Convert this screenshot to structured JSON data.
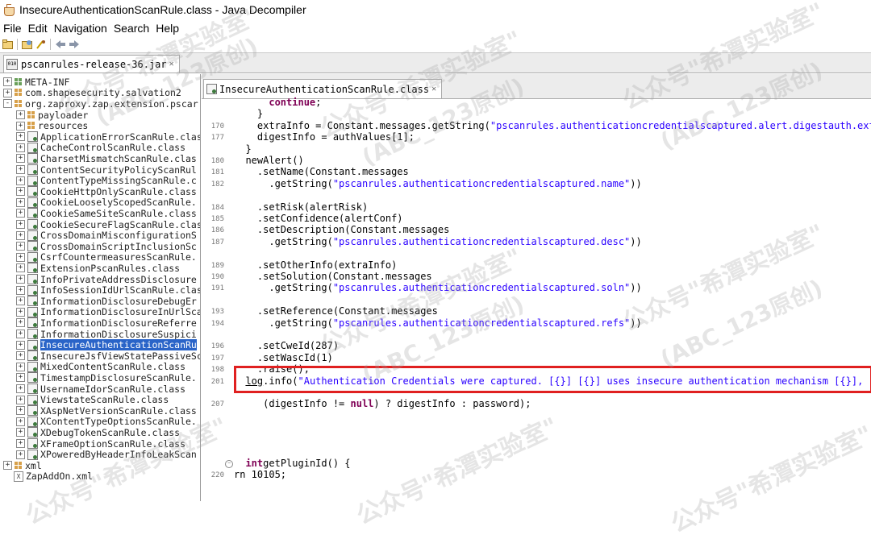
{
  "window": {
    "title": "InsecureAuthenticationScanRule.class - Java Decompiler"
  },
  "menu": [
    "File",
    "Edit",
    "Navigation",
    "Search",
    "Help"
  ],
  "jar_tab": {
    "label": "pscanrules-release-36.jar"
  },
  "code_tab": {
    "label": "InsecureAuthenticationScanRule.class"
  },
  "tree": [
    {
      "label": "META-INF",
      "type": "pkg-green",
      "depth": 0,
      "expander": "+"
    },
    {
      "label": "com.shapesecurity.salvation2",
      "type": "pkg",
      "depth": 0,
      "expander": "+"
    },
    {
      "label": "org.zaproxy.zap.extension.pscar",
      "type": "pkg",
      "depth": 0,
      "expander": "-"
    },
    {
      "label": "payloader",
      "type": "pkg",
      "depth": 1,
      "expander": "+"
    },
    {
      "label": "resources",
      "type": "pkg",
      "depth": 1,
      "expander": "+"
    },
    {
      "label": "ApplicationErrorScanRule.clas",
      "type": "cls",
      "depth": 1,
      "expander": "+"
    },
    {
      "label": "CacheControlScanRule.class",
      "type": "cls",
      "depth": 1,
      "expander": "+"
    },
    {
      "label": "CharsetMismatchScanRule.clas",
      "type": "cls",
      "depth": 1,
      "expander": "+"
    },
    {
      "label": "ContentSecurityPolicyScanRul",
      "type": "cls",
      "depth": 1,
      "expander": "+"
    },
    {
      "label": "ContentTypeMissingScanRule.c",
      "type": "cls",
      "depth": 1,
      "expander": "+"
    },
    {
      "label": "CookieHttpOnlyScanRule.class",
      "type": "cls",
      "depth": 1,
      "expander": "+"
    },
    {
      "label": "CookieLooselyScopedScanRule.",
      "type": "cls",
      "depth": 1,
      "expander": "+"
    },
    {
      "label": "CookieSameSiteScanRule.class",
      "type": "cls",
      "depth": 1,
      "expander": "+"
    },
    {
      "label": "CookieSecureFlagScanRule.clas",
      "type": "cls",
      "depth": 1,
      "expander": "+"
    },
    {
      "label": "CrossDomainMisconfigurationS",
      "type": "cls",
      "depth": 1,
      "expander": "+"
    },
    {
      "label": "CrossDomainScriptInclusionSc",
      "type": "cls",
      "depth": 1,
      "expander": "+"
    },
    {
      "label": "CsrfCountermeasuresScanRule.",
      "type": "cls",
      "depth": 1,
      "expander": "+"
    },
    {
      "label": "ExtensionPscanRules.class",
      "type": "cls",
      "depth": 1,
      "expander": "+"
    },
    {
      "label": "InfoPrivateAddressDisclosure",
      "type": "cls",
      "depth": 1,
      "expander": "+"
    },
    {
      "label": "InfoSessionIdUrlScanRule.clas",
      "type": "cls",
      "depth": 1,
      "expander": "+"
    },
    {
      "label": "InformationDisclosureDebugEr",
      "type": "cls",
      "depth": 1,
      "expander": "+"
    },
    {
      "label": "InformationDisclosureInUrlSca",
      "type": "cls",
      "depth": 1,
      "expander": "+"
    },
    {
      "label": "InformationDisclosureReferre",
      "type": "cls",
      "depth": 1,
      "expander": "+"
    },
    {
      "label": "InformationDisclosureSuspici",
      "type": "cls",
      "depth": 1,
      "expander": "+"
    },
    {
      "label": "InsecureAuthenticationScanRu",
      "type": "cls",
      "depth": 1,
      "expander": "+",
      "selected": true
    },
    {
      "label": "InsecureJsfViewStatePassiveSc",
      "type": "cls",
      "depth": 1,
      "expander": "+"
    },
    {
      "label": "MixedContentScanRule.class",
      "type": "cls",
      "depth": 1,
      "expander": "+"
    },
    {
      "label": "TimestampDisclosureScanRule.",
      "type": "cls",
      "depth": 1,
      "expander": "+"
    },
    {
      "label": "UsernameIdorScanRule.class",
      "type": "cls",
      "depth": 1,
      "expander": "+"
    },
    {
      "label": "ViewstateScanRule.class",
      "type": "cls",
      "depth": 1,
      "expander": "+"
    },
    {
      "label": "XAspNetVersionScanRule.class",
      "type": "cls",
      "depth": 1,
      "expander": "+"
    },
    {
      "label": "XContentTypeOptionsScanRule.",
      "type": "cls",
      "depth": 1,
      "expander": "+"
    },
    {
      "label": "XDebugTokenScanRule.class",
      "type": "cls",
      "depth": 1,
      "expander": "+"
    },
    {
      "label": "XFrameOptionScanRule.class",
      "type": "cls",
      "depth": 1,
      "expander": "+"
    },
    {
      "label": "XPoweredByHeaderInfoLeakScan",
      "type": "cls",
      "depth": 1,
      "expander": "+"
    },
    {
      "label": "xml",
      "type": "pkg",
      "depth": 0,
      "expander": "+"
    },
    {
      "label": "ZapAddOn.xml",
      "type": "xml",
      "depth": 0,
      "expander": ""
    }
  ],
  "code": [
    {
      "ln": "",
      "parts": [
        [
          "",
          "      "
        ],
        [
          "kw",
          "continue"
        ],
        [
          "",
          ";"
        ]
      ]
    },
    {
      "ln": "",
      "parts": [
        [
          "",
          "    }"
        ]
      ]
    },
    {
      "ln": "170",
      "parts": [
        [
          "",
          "    extraInfo = Constant.messages.getString("
        ],
        [
          "str",
          "\"pscanrules.authenticationcredentialscaptured.alert.digestauth.extrainfo\""
        ],
        [
          "",
          ","
        ]
      ]
    },
    {
      "ln": "177",
      "parts": [
        [
          "",
          "    digestInfo = authValues[1];"
        ]
      ]
    },
    {
      "ln": "",
      "parts": [
        [
          "",
          "  }"
        ]
      ]
    },
    {
      "ln": "180",
      "parts": [
        [
          "",
          "  newAlert()"
        ]
      ]
    },
    {
      "ln": "181",
      "parts": [
        [
          "",
          "    .setName(Constant.messages"
        ]
      ]
    },
    {
      "ln": "182",
      "parts": [
        [
          "",
          "      .getString("
        ],
        [
          "str",
          "\"pscanrules.authenticationcredentialscaptured.name\""
        ],
        [
          "",
          "))"
        ]
      ]
    },
    {
      "ln": "",
      "parts": [
        [
          "",
          ""
        ]
      ]
    },
    {
      "ln": "184",
      "parts": [
        [
          "",
          "    .setRisk(alertRisk)"
        ]
      ]
    },
    {
      "ln": "185",
      "parts": [
        [
          "",
          "    .setConfidence(alertConf)"
        ]
      ]
    },
    {
      "ln": "186",
      "parts": [
        [
          "",
          "    .setDescription(Constant.messages"
        ]
      ]
    },
    {
      "ln": "187",
      "parts": [
        [
          "",
          "      .getString("
        ],
        [
          "str",
          "\"pscanrules.authenticationcredentialscaptured.desc\""
        ],
        [
          "",
          "))"
        ]
      ]
    },
    {
      "ln": "",
      "parts": [
        [
          "",
          ""
        ]
      ]
    },
    {
      "ln": "189",
      "parts": [
        [
          "",
          "    .setOtherInfo(extraInfo)"
        ]
      ]
    },
    {
      "ln": "190",
      "parts": [
        [
          "",
          "    .setSolution(Constant.messages"
        ]
      ]
    },
    {
      "ln": "191",
      "parts": [
        [
          "",
          "      .getString("
        ],
        [
          "str",
          "\"pscanrules.authenticationcredentialscaptured.soln\""
        ],
        [
          "",
          "))"
        ]
      ]
    },
    {
      "ln": "",
      "parts": [
        [
          "",
          ""
        ]
      ]
    },
    {
      "ln": "193",
      "parts": [
        [
          "",
          "    .setReference(Constant.messages"
        ]
      ]
    },
    {
      "ln": "194",
      "parts": [
        [
          "",
          "      .getString("
        ],
        [
          "str",
          "\"pscanrules.authenticationcredentialscaptured.refs\""
        ],
        [
          "",
          "))"
        ]
      ]
    },
    {
      "ln": "",
      "parts": [
        [
          "",
          ""
        ]
      ]
    },
    {
      "ln": "196",
      "parts": [
        [
          "",
          "    .setCweId(287)"
        ]
      ]
    },
    {
      "ln": "197",
      "parts": [
        [
          "",
          "    .setWascId(1)"
        ]
      ]
    },
    {
      "ln": "198",
      "parts": [
        [
          "",
          "    .raise();"
        ]
      ]
    },
    {
      "ln": "201",
      "parts": [
        [
          "",
          "  "
        ],
        [
          "link",
          "log"
        ],
        [
          "",
          ".info("
        ],
        [
          "str",
          "\"Authentication Credentials were captured. [{}] [{}] uses insecure authentication mechanism [{}], revealin"
        ]
      ]
    },
    {
      "ln": "",
      "parts": [
        [
          "",
          ""
        ]
      ]
    },
    {
      "ln": "207",
      "parts": [
        [
          "",
          "     (digestInfo != "
        ],
        [
          "kw",
          "null"
        ],
        [
          "",
          ") ? digestInfo : password);"
        ]
      ]
    }
  ],
  "code_tail": [
    {
      "ln": "",
      "parts": [
        [
          "",
          "  "
        ],
        [
          "kw",
          "int"
        ],
        [
          "",
          "getPluginId() {"
        ]
      ]
    },
    {
      "ln": "220",
      "parts": [
        [
          "",
          "rn 10105;"
        ]
      ]
    }
  ],
  "watermark": {
    "line1": "公众号\"希潭实验室\"",
    "line2": "(ABC_123原创)"
  }
}
